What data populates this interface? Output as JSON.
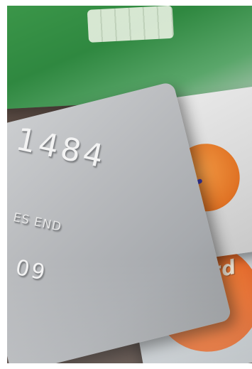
{
  "photo": {
    "embossed_digits": "1484",
    "expires_text": "ES END",
    "year_digits": "09",
    "brand_text": "card"
  },
  "colors": {
    "green_card": "#2f8840",
    "silver_card": "#b9bbbe",
    "orange_circle": "#e3692a",
    "background": "#4b3b34"
  }
}
